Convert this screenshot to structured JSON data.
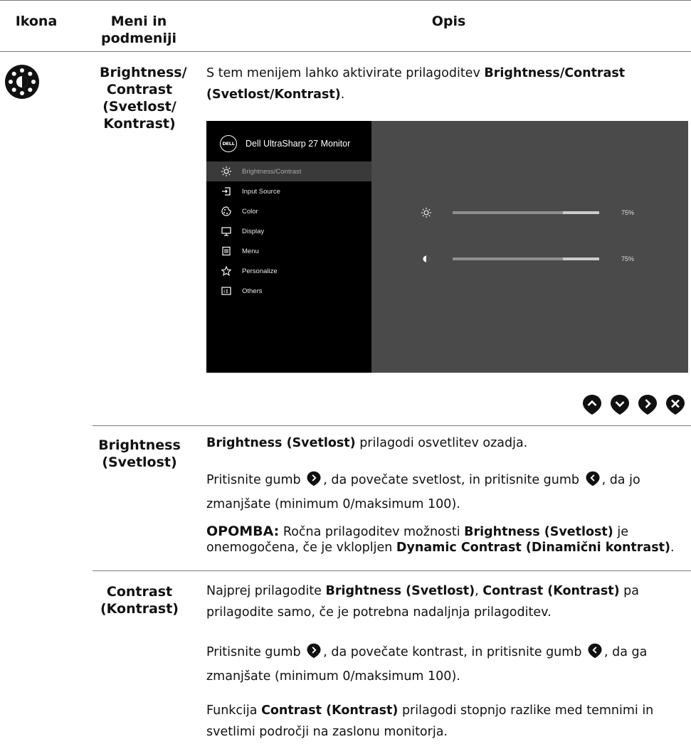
{
  "header": {
    "col_icon": "Ikona",
    "col_menu": "Meni in podmeniji",
    "col_desc": "Opis"
  },
  "section": {
    "icon_name": "brightness-contrast-icon",
    "title": "Brightness/ Contrast (Svetlost/ Kontrast)",
    "desc_prefix": "S tem menijem lahko aktivirate prilagoditev ",
    "desc_bold": "Brightness/Contrast (Svetlost/Kontrast)",
    "desc_suffix": "."
  },
  "osd": {
    "logo": "DELL",
    "title": "Dell UltraSharp 27 Monitor",
    "items": [
      {
        "label": "Brightness/Contrast",
        "icon": "sun-icon",
        "active": true
      },
      {
        "label": "Input Source",
        "icon": "input-source-icon"
      },
      {
        "label": "Color",
        "icon": "color-icon"
      },
      {
        "label": "Display",
        "icon": "display-icon"
      },
      {
        "label": "Menu",
        "icon": "menu-icon"
      },
      {
        "label": "Personalize",
        "icon": "star-icon"
      },
      {
        "label": "Others",
        "icon": "others-icon"
      }
    ],
    "brightness": {
      "value": 0.75,
      "label": "75%"
    },
    "contrast": {
      "value": 0.75,
      "label": "75%"
    }
  },
  "nav_buttons": [
    "up-button",
    "down-button",
    "right-button",
    "close-button"
  ],
  "brightness": {
    "term": "Brightness (Svetlost)",
    "line1_bold": "Brightness (Svetlost)",
    "line1": " prilagodi osvetlitev ozadja.",
    "line2a": "Pritisnite gumb ",
    "line2b": ", da povečate svetlost, in pritisnite gumb ",
    "line2c": ", da jo zmanjšate (minimum 0/maksimum 100).",
    "note_label": "OPOMBA:",
    "note_a": " Ročna prilagoditev možnosti ",
    "note_b": "Brightness (Svetlost)",
    "note_c": " je onemogočena, če je vklopljen ",
    "note_d": "Dynamic Contrast (Dinamični kontrast)",
    "note_e": "."
  },
  "contrast": {
    "term": "Contrast (Kontrast)",
    "p1a": "Najprej prilagodite ",
    "p1b": "Brightness (Svetlost)",
    "p1c": ", ",
    "p1d": "Contrast (Kontrast)",
    "p1e": " pa prilagodite samo, če je potrebna nadaljnja prilagoditev.",
    "p2a": "Pritisnite gumb ",
    "p2b": ", da povečate kontrast, in pritisnite gumb ",
    "p2c": ", da ga zmanjšate (minimum 0/maksimum 100).",
    "p3a": "Funkcija ",
    "p3b": "Contrast (Kontrast)",
    "p3c": " prilagodi stopnjo razlike med temnimi in svetlimi področji na zaslonu monitorja."
  }
}
